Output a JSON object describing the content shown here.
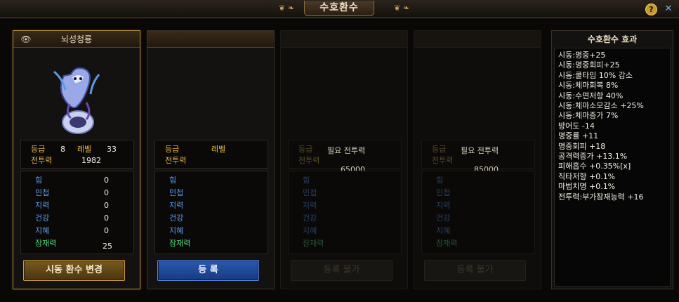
{
  "window": {
    "title": "수호환수"
  },
  "header": {
    "help_label": "?",
    "close_label": "✕"
  },
  "cards": [
    {
      "name": "뇌성청룡",
      "grade_label": "등급",
      "grade_value": "8",
      "level_label": "레벨",
      "level_value": "33",
      "power_label": "전투력",
      "power_value": "1982",
      "stats": [
        {
          "label": "힘",
          "value": "0"
        },
        {
          "label": "민첩",
          "value": "0"
        },
        {
          "label": "지력",
          "value": "0"
        },
        {
          "label": "건강",
          "value": "0"
        },
        {
          "label": "지혜",
          "value": "0"
        },
        {
          "label": "잠재력",
          "value": "25"
        }
      ],
      "button_label": "시동 환수 변경"
    },
    {
      "grade_label": "등급",
      "level_label": "레벨",
      "power_label": "전투력",
      "stats": [
        {
          "label": "힘"
        },
        {
          "label": "민첩"
        },
        {
          "label": "지력"
        },
        {
          "label": "건강"
        },
        {
          "label": "지혜"
        },
        {
          "label": "잠재력"
        }
      ],
      "button_label": "등 록"
    },
    {
      "grade_label": "등급",
      "power_label": "전투력",
      "need_label": "필요 전투력",
      "need_value": "65000",
      "stats": [
        {
          "label": "힘"
        },
        {
          "label": "민첩"
        },
        {
          "label": "지력"
        },
        {
          "label": "건강"
        },
        {
          "label": "지혜"
        },
        {
          "label": "잠재력"
        }
      ],
      "button_label": "등록 불가"
    },
    {
      "grade_label": "등급",
      "power_label": "전투력",
      "need_label": "필요 전투력",
      "need_value": "85000",
      "stats": [
        {
          "label": "힘"
        },
        {
          "label": "민첩"
        },
        {
          "label": "지력"
        },
        {
          "label": "건강"
        },
        {
          "label": "지혜"
        },
        {
          "label": "잠재력"
        }
      ],
      "button_label": "등록 불가"
    }
  ],
  "effects": {
    "title": "수호환수 효과",
    "lines": [
      "시동:명중+25",
      "시동:명중회피+25",
      "시동:쿨타임 10% 감소",
      "시동:체마회복 8%",
      "시동:수면저항 40%",
      "시동:체마소모감소 +25%",
      "시동:체마증가 7%",
      "방어도 -14",
      "명중률 +11",
      "명중회피 +18",
      "공격력증가 +13.1%",
      "피해흡수 +0.35%[x]",
      "직타저항 +0.1%",
      "마법치명 +0.1%",
      "전투력:부가잠재능력 +16"
    ]
  },
  "colors": {
    "gold": "#e3b24a",
    "blue": "#5a9af0",
    "green": "#54d67a",
    "frame": "#a8843c"
  }
}
